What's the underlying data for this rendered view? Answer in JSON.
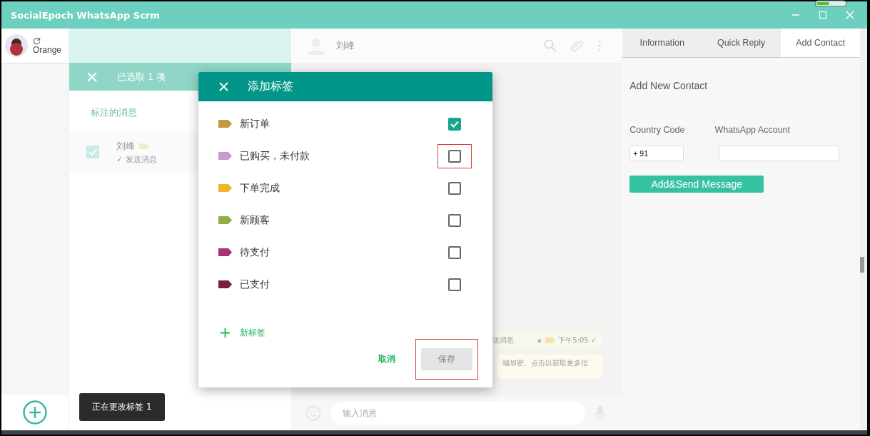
{
  "window": {
    "title": "SocialEpoch WhatsApp Scrm"
  },
  "account": {
    "name": "Orange"
  },
  "chat_list": {
    "selection_title": "已选取 1 项",
    "section": "标注的消息",
    "items": [
      {
        "name": "刘峰",
        "preview": "✓ 发送消息",
        "selected": true
      }
    ]
  },
  "chat": {
    "contact": "刘峰",
    "messages": [
      {
        "kind": "sent",
        "text": "送消息",
        "star": "★",
        "time": "下午5:05 ✓"
      },
      {
        "kind": "notice",
        "text": "端加密。点击以获取更多信"
      }
    ],
    "input": {
      "placeholder": "输入消息"
    }
  },
  "right_panel": {
    "tabs": [
      {
        "label": "Information",
        "selected": false
      },
      {
        "label": "Quick Reply",
        "selected": false
      },
      {
        "label": "Add Contact",
        "selected": true
      }
    ],
    "heading": "Add New Contact",
    "country_code_label": "Country Code",
    "account_label": "WhatsApp Account",
    "country_code": "+ 91",
    "submit": "Add&Send Message"
  },
  "dialog": {
    "title": "添加标签",
    "labels": [
      {
        "name": "新订单",
        "color": "#c49a3a",
        "checked": true,
        "highlighted": false
      },
      {
        "name": "已购买，未付款",
        "color": "#c99ad0",
        "checked": false,
        "highlighted": true
      },
      {
        "name": "下单完成",
        "color": "#f0b429",
        "checked": false,
        "highlighted": false
      },
      {
        "name": "新顾客",
        "color": "#8fae45",
        "checked": false,
        "highlighted": false
      },
      {
        "name": "待支付",
        "color": "#a83070",
        "checked": false,
        "highlighted": false
      },
      {
        "name": "已支付",
        "color": "#7a1f3a",
        "checked": false,
        "highlighted": false
      }
    ],
    "new_label": "新标签",
    "cancel": "取消",
    "save": "保存",
    "save_highlighted": true
  },
  "toast": "正在更改标签 1"
}
